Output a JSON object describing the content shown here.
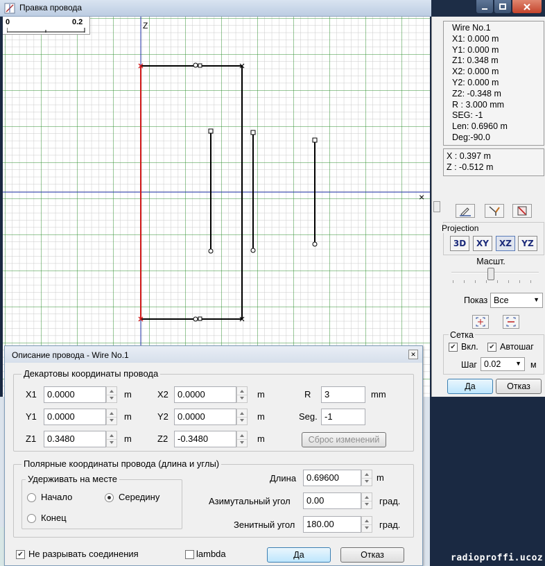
{
  "window": {
    "title": "Правка провода"
  },
  "canvas": {
    "scale_zero": "0",
    "scale_max": "0.2",
    "axis_label": "Z",
    "cursor_marker": "×"
  },
  "wire_info": {
    "lines": [
      "Wire No.1",
      "X1: 0.000 m",
      "Y1: 0.000 m",
      "Z1: 0.348 m",
      "X2: 0.000 m",
      "Y2: 0.000 m",
      "Z2: -0.348 m",
      "R : 3.000 mm",
      "SEG: -1",
      "Len: 0.6960 m",
      "Deg:-90.0"
    ]
  },
  "cursor_info": {
    "x": "X : 0.397 m",
    "z": "Z : -0.512 m"
  },
  "projection": {
    "label": "Projection",
    "buttons": [
      "3D",
      "XY",
      "XZ",
      "YZ"
    ],
    "selected": "XZ"
  },
  "zoom": {
    "label": "Масшт."
  },
  "show": {
    "label": "Показ",
    "value": "Все"
  },
  "grid": {
    "label": "Сетка",
    "enabled_label": "Вкл.",
    "enabled": true,
    "autostep_label": "Автошаг",
    "autostep": true,
    "step_label": "Шаг",
    "step_value": "0.02",
    "step_unit": "м"
  },
  "panel_buttons": {
    "ok": "Да",
    "cancel": "Отказ"
  },
  "dialog": {
    "title": "Описание провода - Wire No.1",
    "cartesian": {
      "label": "Декартовы координаты провода",
      "x1": {
        "label": "X1",
        "value": "0.0000",
        "unit": "m"
      },
      "y1": {
        "label": "Y1",
        "value": "0.0000",
        "unit": "m"
      },
      "z1": {
        "label": "Z1",
        "value": "0.3480",
        "unit": "m"
      },
      "x2": {
        "label": "X2",
        "value": "0.0000",
        "unit": "m"
      },
      "y2": {
        "label": "Y2",
        "value": "0.0000",
        "unit": "m"
      },
      "z2": {
        "label": "Z2",
        "value": "-0.3480",
        "unit": "m"
      },
      "r": {
        "label": "R",
        "value": "3",
        "unit": "mm"
      },
      "seg": {
        "label": "Seg.",
        "value": "-1"
      },
      "reset": "Сброс изменений"
    },
    "polar": {
      "label": "Полярные координаты провода (длина и углы)",
      "hold": {
        "label": "Удерживать на месте",
        "start": "Начало",
        "middle": "Середину",
        "end": "Конец",
        "selected": "middle"
      },
      "length": {
        "label": "Длина",
        "value": "0.69600",
        "unit": "m"
      },
      "azimuth": {
        "label": "Азимутальный угол",
        "value": "0.00",
        "unit": "град."
      },
      "zenith": {
        "label": "Зенитный угол",
        "value": "180.00",
        "unit": "град."
      }
    },
    "keep_connections": {
      "label": "Не разрывать соединения",
      "checked": true
    },
    "lambda": {
      "label": "lambda",
      "checked": false
    },
    "ok": "Да",
    "cancel": "Отказ"
  },
  "watermark": "radioproffi.ucoz.ua"
}
